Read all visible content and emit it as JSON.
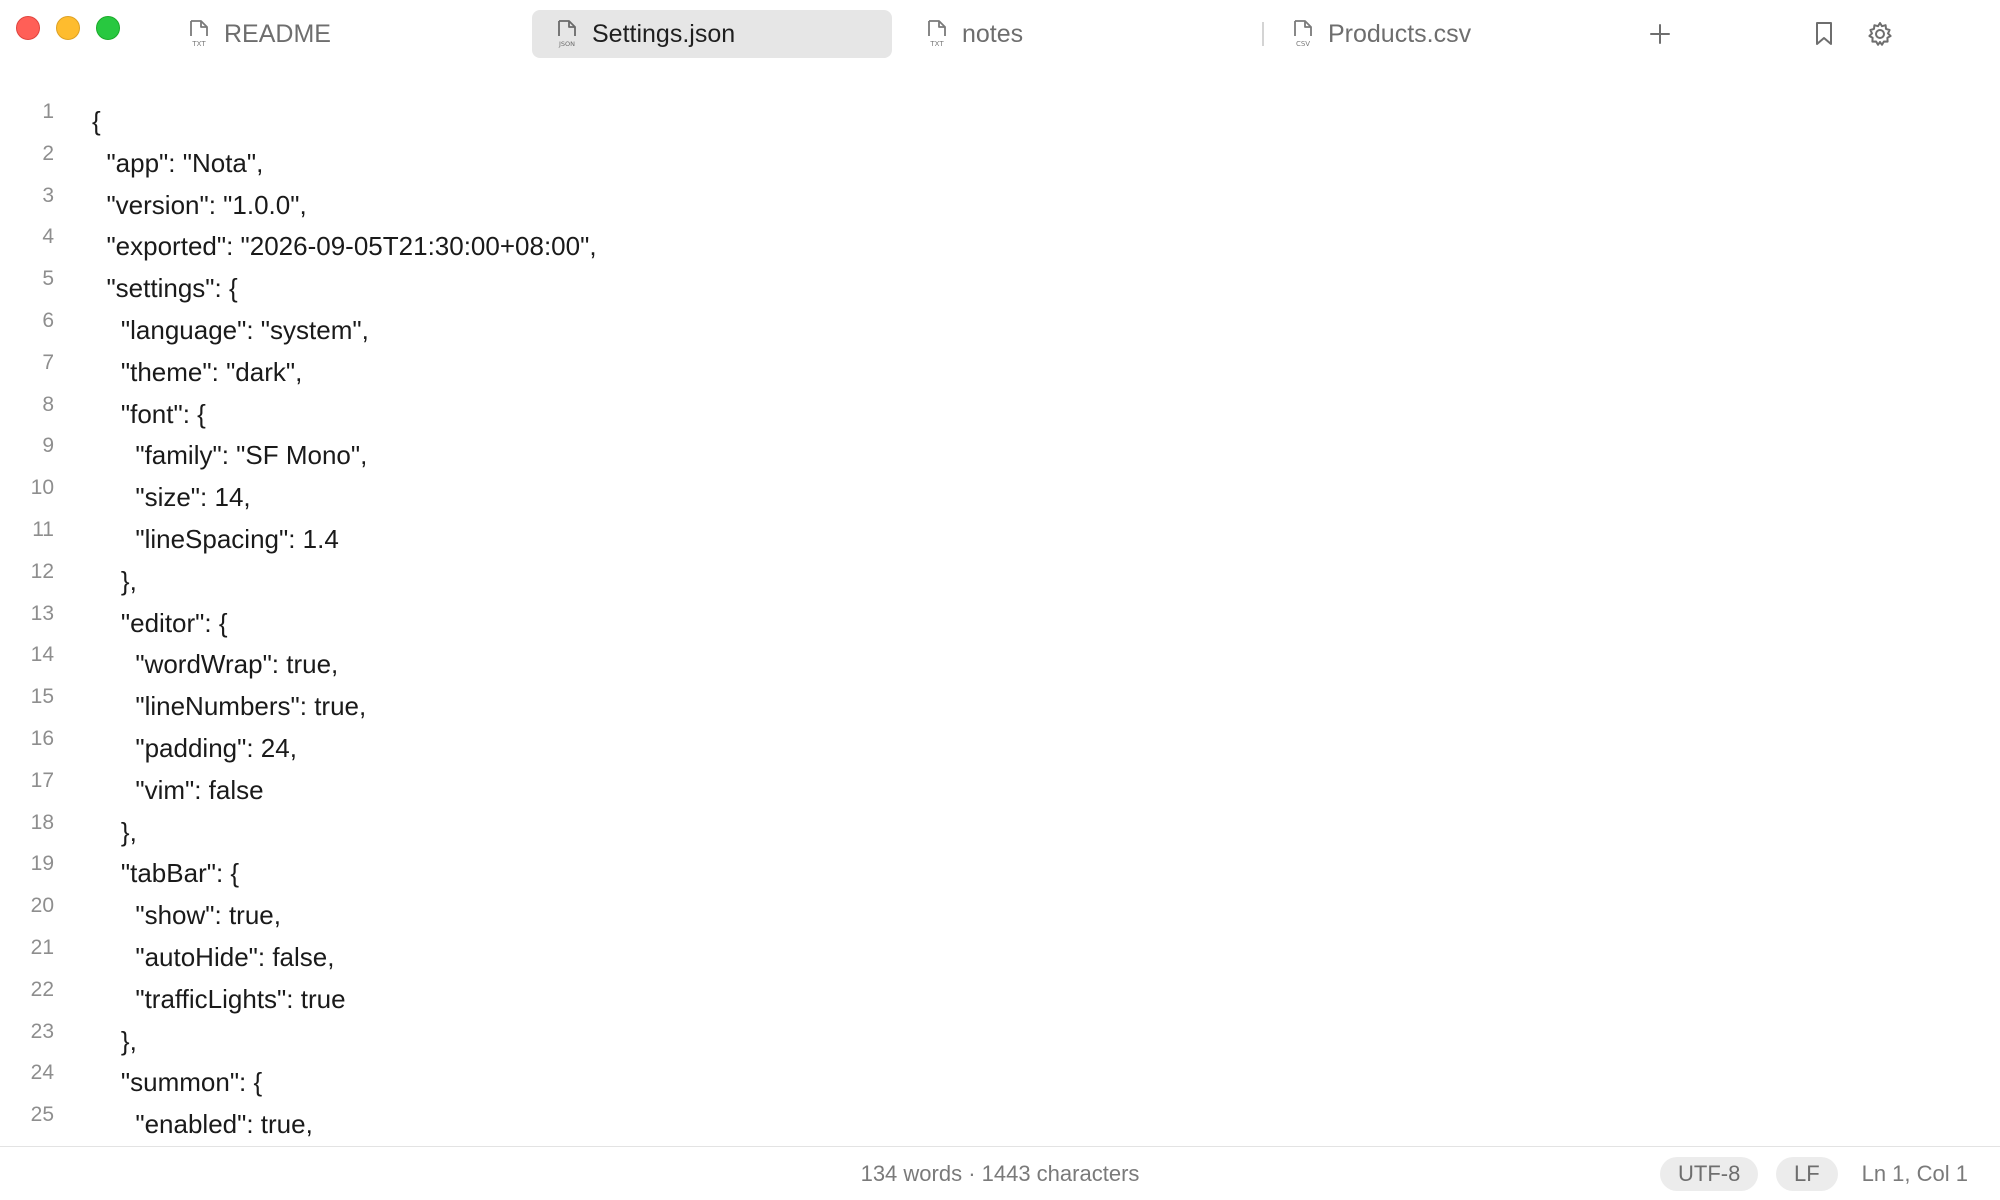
{
  "window": {
    "traffic_lights": [
      "close",
      "minimize",
      "zoom"
    ]
  },
  "tabs": [
    {
      "label": "README",
      "file_type": "TXT",
      "active": false
    },
    {
      "label": "Settings.json",
      "file_type": "JSON",
      "active": true
    },
    {
      "label": "notes",
      "file_type": "TXT",
      "active": false
    },
    {
      "label": "Products.csv",
      "file_type": "CSV",
      "active": false
    }
  ],
  "toolbar": {
    "new_tab_icon": "plus-icon",
    "bookmark_icon": "bookmark-icon",
    "settings_icon": "gear-icon"
  },
  "editor": {
    "lines": [
      {
        "n": "1",
        "text": "{"
      },
      {
        "n": "2",
        "text": "  \"app\": \"Nota\","
      },
      {
        "n": "3",
        "text": "  \"version\": \"1.0.0\","
      },
      {
        "n": "4",
        "text": "  \"exported\": \"2026-09-05T21:30:00+08:00\","
      },
      {
        "n": "5",
        "text": "  \"settings\": {"
      },
      {
        "n": "6",
        "text": "    \"language\": \"system\","
      },
      {
        "n": "7",
        "text": "    \"theme\": \"dark\","
      },
      {
        "n": "8",
        "text": "    \"font\": {"
      },
      {
        "n": "9",
        "text": "      \"family\": \"SF Mono\","
      },
      {
        "n": "10",
        "text": "      \"size\": 14,"
      },
      {
        "n": "11",
        "text": "      \"lineSpacing\": 1.4"
      },
      {
        "n": "12",
        "text": "    },"
      },
      {
        "n": "13",
        "text": "    \"editor\": {"
      },
      {
        "n": "14",
        "text": "      \"wordWrap\": true,"
      },
      {
        "n": "15",
        "text": "      \"lineNumbers\": true,"
      },
      {
        "n": "16",
        "text": "      \"padding\": 24,"
      },
      {
        "n": "17",
        "text": "      \"vim\": false"
      },
      {
        "n": "18",
        "text": "    },"
      },
      {
        "n": "19",
        "text": "    \"tabBar\": {"
      },
      {
        "n": "20",
        "text": "      \"show\": true,"
      },
      {
        "n": "21",
        "text": "      \"autoHide\": false,"
      },
      {
        "n": "22",
        "text": "      \"trafficLights\": true"
      },
      {
        "n": "23",
        "text": "    },"
      },
      {
        "n": "24",
        "text": "    \"summon\": {"
      },
      {
        "n": "25",
        "text": "      \"enabled\": true,"
      }
    ]
  },
  "status": {
    "counts": "134 words · 1443 characters",
    "encoding": "UTF-8",
    "line_ending": "LF",
    "cursor": "Ln 1, Col 1"
  },
  "colors": {
    "close": "#ff5f57",
    "minimize": "#febc2e",
    "zoom": "#28c840",
    "active_tab": "#e6e6e6"
  }
}
